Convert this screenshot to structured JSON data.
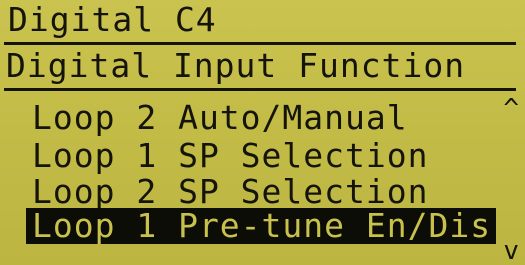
{
  "screen": {
    "title": "Digital C4",
    "subtitle": "Digital Input Function"
  },
  "menu": {
    "items": [
      {
        "label": "Loop 2 Auto/Manual"
      },
      {
        "label": "Loop 1 SP Selection"
      },
      {
        "label": "Loop 2 SP Selection"
      },
      {
        "label": "Loop 1 Pre-tune En/Dis"
      }
    ],
    "selected_index": 3
  },
  "scroll": {
    "up_icon": "chevron-up-icon",
    "down_icon": "chevron-down-icon"
  },
  "colors": {
    "lcd_background": "#c4bd4a",
    "lcd_text": "#15140a",
    "highlight_background": "#0d0d08"
  }
}
